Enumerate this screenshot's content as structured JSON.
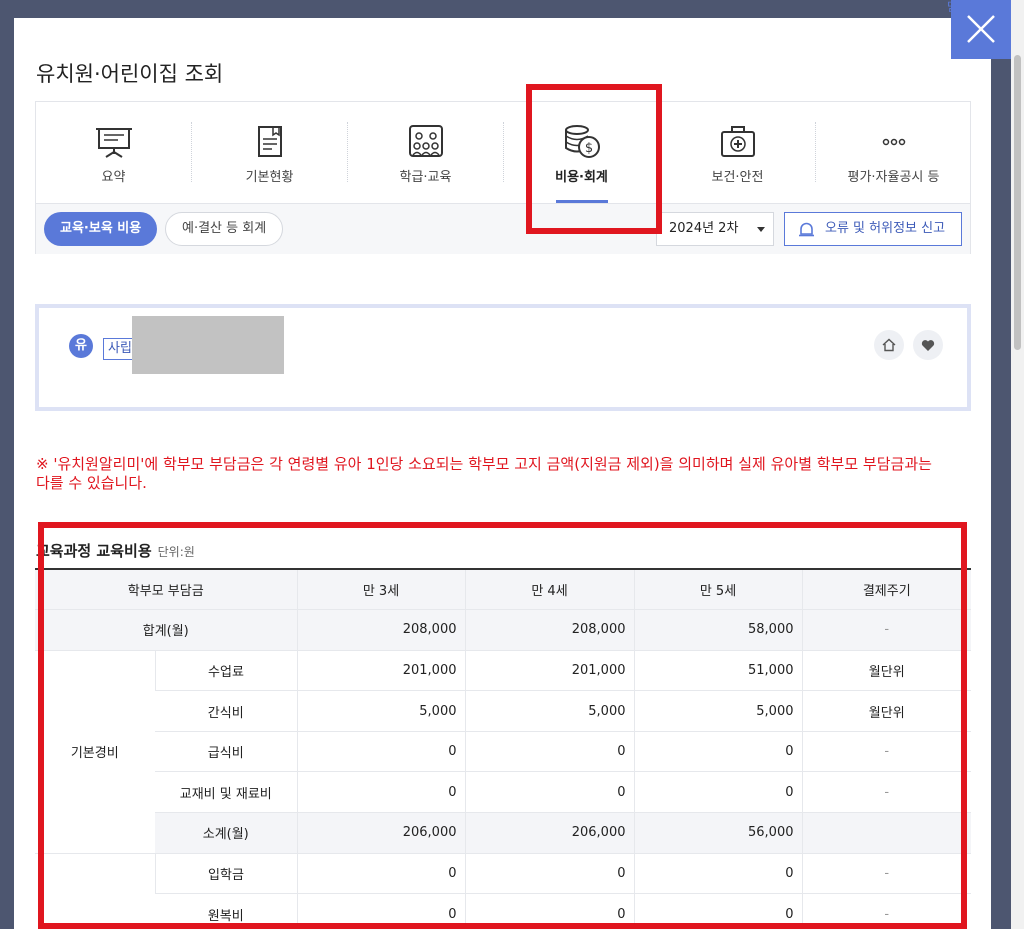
{
  "modal": {
    "title": "유치원·어린이집 조회",
    "close_label": "닫기"
  },
  "tabs": [
    {
      "label": "요약",
      "icon": "presentation-board-icon"
    },
    {
      "label": "기본현황",
      "icon": "document-icon"
    },
    {
      "label": "학급·교육",
      "icon": "group-people-icon"
    },
    {
      "label": "비용·회계",
      "icon": "coins-dollar-icon",
      "active": true
    },
    {
      "label": "보건·안전",
      "icon": "first-aid-kit-icon"
    },
    {
      "label": "평가·자율공시 등",
      "icon": "more-dots-icon"
    }
  ],
  "subtabs": {
    "active": "교육·보육 비용",
    "inactive": "예·결산 등 회계"
  },
  "period": {
    "selected": "2024년 2차"
  },
  "report_button": "오류 및 허위정보 신고",
  "institution": {
    "badge": "유",
    "type": "사립"
  },
  "notice": "※ '유치원알리미'에 학부모 부담금은 각 연령별 유아 1인당 소요되는 학부모 고지 금액(지원금 제외)을 의미하며 실제 유아별 학부모 부담금과는 다를 수 있습니다.",
  "section": {
    "title": "교육과정 교육비용",
    "unit": "단위:원"
  },
  "table": {
    "headers": [
      "학부모 부담금",
      "만 3세",
      "만 4세",
      "만 5세",
      "결제주기"
    ],
    "total": {
      "label": "합계(월)",
      "v3": "208,000",
      "v4": "208,000",
      "v5": "58,000",
      "cycle": "-"
    },
    "basic_group": "기본경비",
    "basic_rows": [
      {
        "label": "수업료",
        "v3": "201,000",
        "v4": "201,000",
        "v5": "51,000",
        "cycle": "월단위"
      },
      {
        "label": "간식비",
        "v3": "5,000",
        "v4": "5,000",
        "v5": "5,000",
        "cycle": "월단위"
      },
      {
        "label": "급식비",
        "v3": "0",
        "v4": "0",
        "v5": "0",
        "cycle": "-"
      },
      {
        "label": "교재비 및 재료비",
        "v3": "0",
        "v4": "0",
        "v5": "0",
        "cycle": "-"
      }
    ],
    "subtotal": {
      "label": "소계(월)",
      "v3": "206,000",
      "v4": "206,000",
      "v5": "56,000",
      "cycle": ""
    },
    "extra_rows": [
      {
        "label": "입학금",
        "v3": "0",
        "v4": "0",
        "v5": "0",
        "cycle": "-"
      },
      {
        "label": "원복비",
        "v3": "0",
        "v4": "0",
        "v5": "0",
        "cycle": "-"
      }
    ]
  },
  "colors": {
    "accent": "#5a79d9",
    "highlight": "#e0161f",
    "backdrop": "#4d5670"
  }
}
